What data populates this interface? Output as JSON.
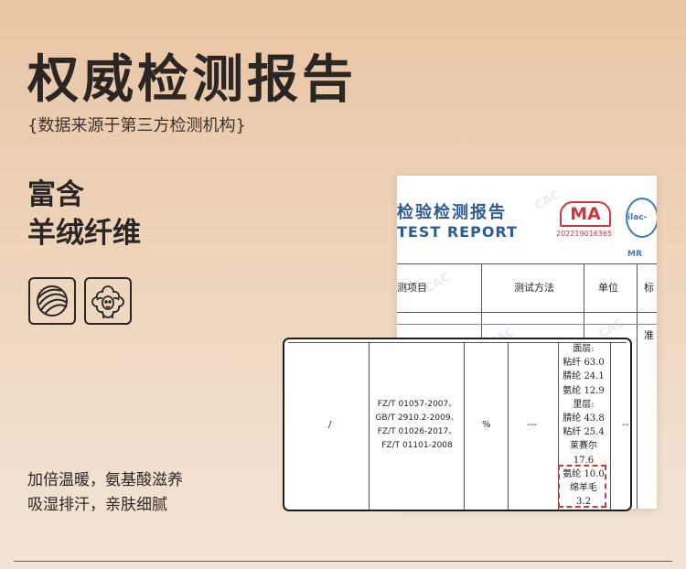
{
  "page": {
    "title": "权威检测报告",
    "subtitle": "{数据来源于第三方检测机构}",
    "feature_line1": "富含",
    "feature_line2": "羊绒纤维",
    "icons": [
      "wool-yarn-icon",
      "sheep-icon"
    ],
    "benefit_line1": "加倍温暖，氨基酸滋养",
    "benefit_line2": "吸湿排汗，亲肤细腻"
  },
  "report": {
    "title_cn": "检验检测报告",
    "title_en": "TEST REPORT",
    "cma_label": "MA",
    "cma_number": "202219016365",
    "ilac_label": "ilac-MR",
    "watermark": "CAC",
    "headers": {
      "item": "测项目",
      "method": "测试方法",
      "unit": "单位",
      "standard": "标准"
    }
  },
  "zoom_table": {
    "col_item": "/",
    "standards": [
      "FZ/T 01057-2007、",
      "GB/T 2910.2-2009、",
      "FZ/T 01026-2017、",
      "FZ/T 01101-2008"
    ],
    "unit": "%",
    "method": "---",
    "limit": "--",
    "composition": [
      "面层:",
      "粘纤 63.0",
      "腈纶 24.1",
      "氨纶 12.9",
      "里层:",
      "腈纶 43.8",
      "粘纤 25.4",
      "莱赛尔",
      "17.6",
      "氨纶 10.0",
      "绵羊毛",
      "3.2"
    ]
  }
}
